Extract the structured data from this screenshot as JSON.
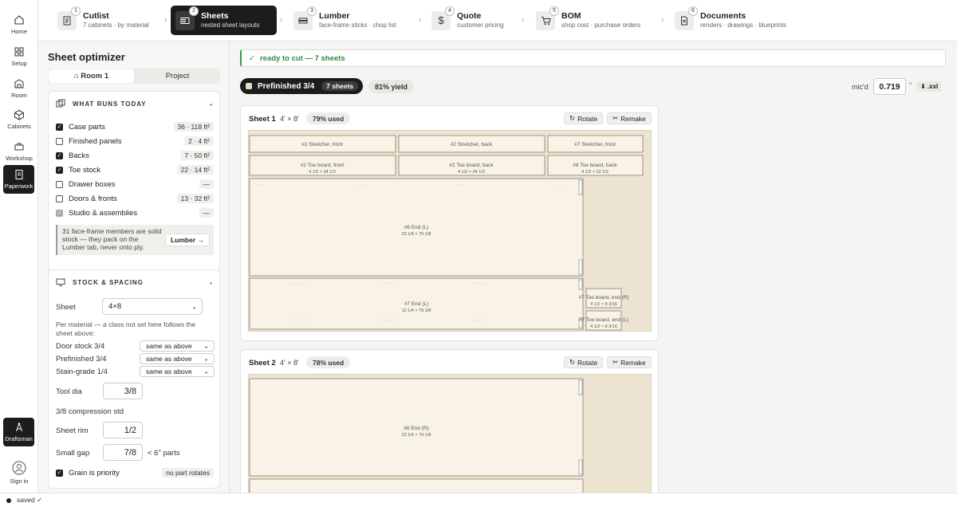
{
  "rail": {
    "items": [
      {
        "label": "Home",
        "icon": "home-icon"
      },
      {
        "label": "Setup",
        "icon": "grid-icon"
      },
      {
        "label": "Room",
        "icon": "room-icon"
      },
      {
        "label": "Cabinets",
        "icon": "cube-icon"
      },
      {
        "label": "Workshop",
        "icon": "tools-icon"
      },
      {
        "label": "Paperwork",
        "icon": "document-icon"
      }
    ],
    "draftsman": "Draftsman",
    "signin": "Sign in"
  },
  "steps": [
    {
      "num": "1",
      "title": "Cutlist",
      "sub": "7 cabinets · by material",
      "icon": "list-icon"
    },
    {
      "num": "2",
      "title": "Sheets",
      "sub": "nested sheet layouts",
      "icon": "sheet-icon"
    },
    {
      "num": "3",
      "title": "Lumber",
      "sub": "face-frame sticks · chop list",
      "icon": "lumber-icon"
    },
    {
      "num": "4",
      "title": "Quote",
      "sub": "customer pricing",
      "icon": "dollar-icon"
    },
    {
      "num": "5",
      "title": "BOM",
      "sub": "shop cost · purchase orders",
      "icon": "cart-icon"
    },
    {
      "num": "6",
      "title": "Documents",
      "sub": "renders · drawings · blueprints",
      "icon": "doc-icon"
    }
  ],
  "panel": {
    "title": "Sheet optimizer",
    "scope_tabs": [
      "⌂ Room 1",
      "Project"
    ],
    "runs": {
      "heading": "WHAT RUNS TODAY",
      "items": [
        {
          "label": "Case parts",
          "count": "36 · 118 ft²",
          "state": "checked"
        },
        {
          "label": "Finished panels",
          "count": "2 · 4 ft²",
          "state": "unchecked"
        },
        {
          "label": "Backs",
          "count": "7 · 50 ft²",
          "state": "checked"
        },
        {
          "label": "Toe stock",
          "count": "22 · 14 ft²",
          "state": "checked"
        },
        {
          "label": "Drawer boxes",
          "count": "—",
          "state": "unchecked"
        },
        {
          "label": "Doors & fronts",
          "count": "13 · 32 ft²",
          "state": "unchecked"
        },
        {
          "label": "Studio & assemblies",
          "count": "—",
          "state": "disabled"
        }
      ],
      "note": "31 face-frame members are solid stock — they pack on the Lumber tab, never onto ply.",
      "note_button": "Lumber →"
    },
    "stock": {
      "heading": "STOCK & SPACING",
      "sheet_label": "Sheet",
      "sheet_value": "4×8",
      "per_material_note": "Per material — a class not set here follows the sheet above:",
      "materials": [
        {
          "label": "Door stock 3/4",
          "value": "same as above"
        },
        {
          "label": "Prefinished 3/4",
          "value": "same as above"
        },
        {
          "label": "Stain-grade 1/4",
          "value": "same as above"
        }
      ],
      "tool_dia_label": "Tool dia",
      "tool_dia": "3/8",
      "tool_note": "3/8 compression std",
      "rim_label": "Sheet rim",
      "rim": "1/2",
      "gap_label": "Small gap",
      "gap": "7/8",
      "gap_note": "< 6\" parts",
      "grain_label": "Grain is priority",
      "grain_note": "no part rotates"
    }
  },
  "main": {
    "ready": "ready to cut — 7 sheets",
    "material_tab": "Prefinished 3/4",
    "material_count": "7 sheets",
    "yield": "81% yield",
    "micd_label": "mic'd",
    "micd_value": "0.719",
    "micd_unit": "\"",
    "export_label": "⬇ .xxl",
    "rotate_label": "Rotate",
    "remake_label": "Remake",
    "sheets": [
      {
        "title": "Sheet 1",
        "dims": "4′ × 8′",
        "used": "79% used",
        "parts": [
          {
            "name": "#2 Stretcher, front",
            "size": ""
          },
          {
            "name": "#2 Stretcher, back",
            "size": ""
          },
          {
            "name": "#7 Stretcher, front",
            "size": ""
          },
          {
            "name": "#2 Toe board, front",
            "size": "4 1/2 × 34 1/2"
          },
          {
            "name": "#2 Toe board, back",
            "size": "4 1/2 × 34 1/2"
          },
          {
            "name": "#6 Toe board, back",
            "size": "4 1/2 × 22 1/2"
          },
          {
            "name": "#6 End (L)",
            "size": "23 1/4 × 79 1/8"
          },
          {
            "name": "#7 End (L)",
            "size": "12 1/4 × 79 1/8"
          },
          {
            "name": "#7 Toe board, end (R)",
            "size": "4 1/2 × 8 3/16"
          },
          {
            "name": "#7 Toe board, end (L)",
            "size": "4 1/2 × 8 3/16"
          }
        ]
      },
      {
        "title": "Sheet 2",
        "dims": "4′ × 8′",
        "used": "78% used",
        "parts": [
          {
            "name": "#6 End (R)",
            "size": "23 1/4 × 79 1/8"
          }
        ]
      }
    ]
  },
  "status": "saved ✓"
}
